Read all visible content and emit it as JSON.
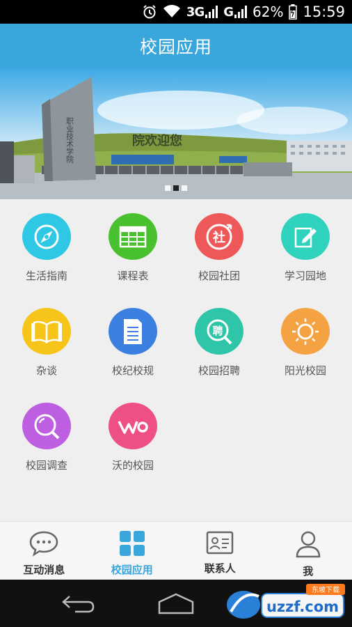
{
  "status_bar": {
    "network_3g": "3G",
    "network_g": "G",
    "battery": "62%",
    "time": "15:59"
  },
  "title_bar": {
    "title": "校园应用"
  },
  "banner": {
    "sign_text": "院欢迎您",
    "side_text": "职业技术学院",
    "slides": 3,
    "active_slide": 2
  },
  "apps": [
    {
      "label": "生活指南",
      "icon": "compass-icon",
      "color": "#2fc8e4"
    },
    {
      "label": "课程表",
      "icon": "table-icon",
      "color": "#49c12e"
    },
    {
      "label": "校园社团",
      "icon": "club-icon",
      "color": "#ef5858",
      "glyph": "社"
    },
    {
      "label": "学习园地",
      "icon": "edit-note-icon",
      "color": "#2fd3bd"
    },
    {
      "label": "杂谈",
      "icon": "book-icon",
      "color": "#f7c51a"
    },
    {
      "label": "校纪校规",
      "icon": "document-icon",
      "color": "#3b7fe0"
    },
    {
      "label": "校园招聘",
      "icon": "recruit-icon",
      "color": "#2fc5a8",
      "glyph": "聘"
    },
    {
      "label": "阳光校园",
      "icon": "sun-icon",
      "color": "#f5a342"
    },
    {
      "label": "校园调查",
      "icon": "magnifier-icon",
      "color": "#bd5fe0"
    },
    {
      "label": "沃的校园",
      "icon": "wo-logo-icon",
      "color": "#ee4f86"
    }
  ],
  "tabs": [
    {
      "label": "互动消息",
      "icon": "chat-icon",
      "active": false
    },
    {
      "label": "校园应用",
      "icon": "apps-grid-icon",
      "active": true
    },
    {
      "label": "联系人",
      "icon": "contact-card-icon",
      "active": false
    },
    {
      "label": "我",
      "icon": "person-icon",
      "active": false
    }
  ],
  "watermark": {
    "text": "uzzf.com",
    "subtext": "东坡下载"
  },
  "colors": {
    "accent": "#3aa7dc",
    "tab_active": "#3aa7dc"
  }
}
